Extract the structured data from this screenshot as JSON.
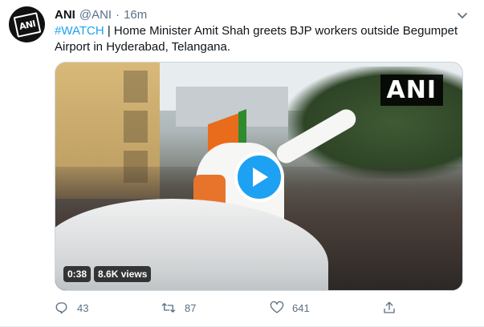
{
  "tweet": {
    "author_name": "ANI",
    "handle": "@ANI",
    "separator": "·",
    "time": "16m",
    "avatar_text": "ANI",
    "text_hashtag": "#WATCH",
    "text_body": " | Home Minister Amit Shah greets BJP workers outside Begumpet Airport in Hyderabad, Telangana."
  },
  "media": {
    "watermark": "ANI",
    "duration": "0:38",
    "views": "8.6K views"
  },
  "actions": {
    "reply_count": "43",
    "retweet_count": "87",
    "like_count": "641"
  },
  "colors": {
    "accent": "#1da1f2",
    "secondary_text": "#5b7083"
  },
  "icons": [
    "chevron-down-icon",
    "play-icon",
    "reply-icon",
    "retweet-icon",
    "like-icon",
    "share-icon"
  ]
}
